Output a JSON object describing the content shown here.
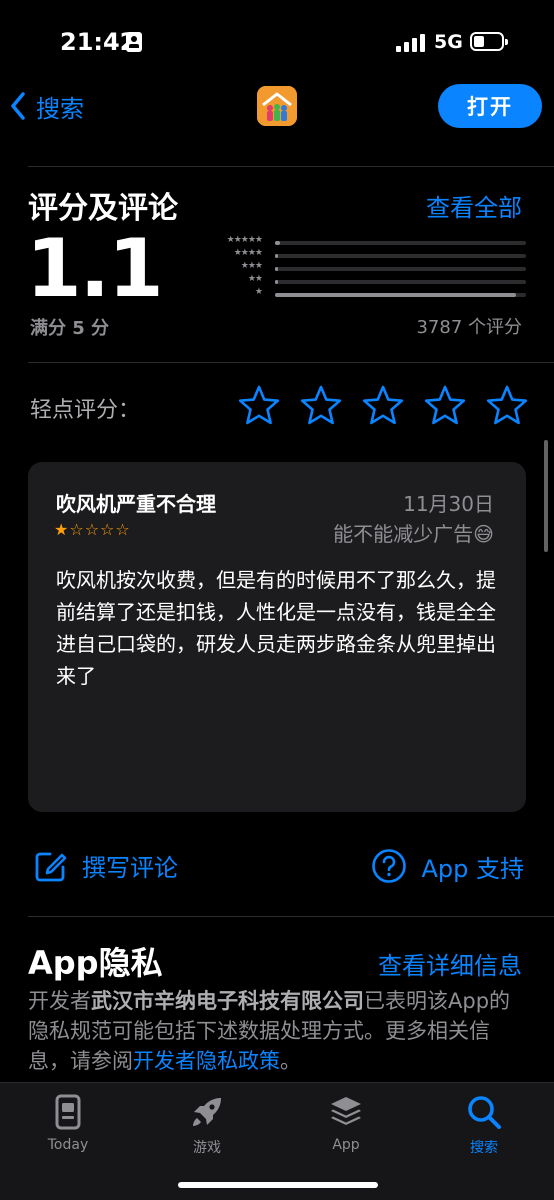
{
  "status_bar": {
    "time": "21:42",
    "network": "5G"
  },
  "nav": {
    "back_label": "搜索",
    "open_label": "打开",
    "app_icon": "family-house-icon"
  },
  "ratings": {
    "title": "评分及评论",
    "see_all": "查看全部",
    "score": "1.1",
    "out_of": "满分 5 分",
    "count": "3787 个评分",
    "distribution": [
      {
        "stars": "★★★★★",
        "fraction": 0.02
      },
      {
        "stars": "★★★★",
        "fraction": 0.01
      },
      {
        "stars": "★★★",
        "fraction": 0.01
      },
      {
        "stars": "★★",
        "fraction": 0.01
      },
      {
        "stars": "★",
        "fraction": 0.96
      }
    ],
    "tap_label": "轻点评分："
  },
  "review": {
    "title": "吹风机严重不合理",
    "date": "11月30日",
    "stars": "★☆☆☆☆",
    "author": "能不能减少广告😅",
    "body": "吹风机按次收费，但是有的时候用不了那么久，提前结算了还是扣钱，人性化是一点没有，钱是全全进自己口袋的，研发人员走两步路金条从兜里掉出来了"
  },
  "actions": {
    "write_review": "撰写评论",
    "app_support": "App 支持"
  },
  "privacy": {
    "title": "App隐私",
    "see_details": "查看详细信息",
    "text_prefix": "开发者",
    "developer": "武汉市辛纳电子科技有限公司",
    "text_mid": "已表明该App的隐私规范可能包括下述数据处理方式。更多相关信息，请参阅",
    "policy_link": "开发者隐私政策",
    "text_suffix": "。"
  },
  "tabs": [
    {
      "label": "Today",
      "icon": "today-icon"
    },
    {
      "label": "游戏",
      "icon": "rocket-icon"
    },
    {
      "label": "App",
      "icon": "layers-icon"
    },
    {
      "label": "搜索",
      "icon": "search-icon",
      "active": true
    }
  ],
  "colors": {
    "accent": "#0a84ff",
    "star": "#ff9f0a",
    "background": "#000000",
    "card": "#1c1c1e"
  }
}
